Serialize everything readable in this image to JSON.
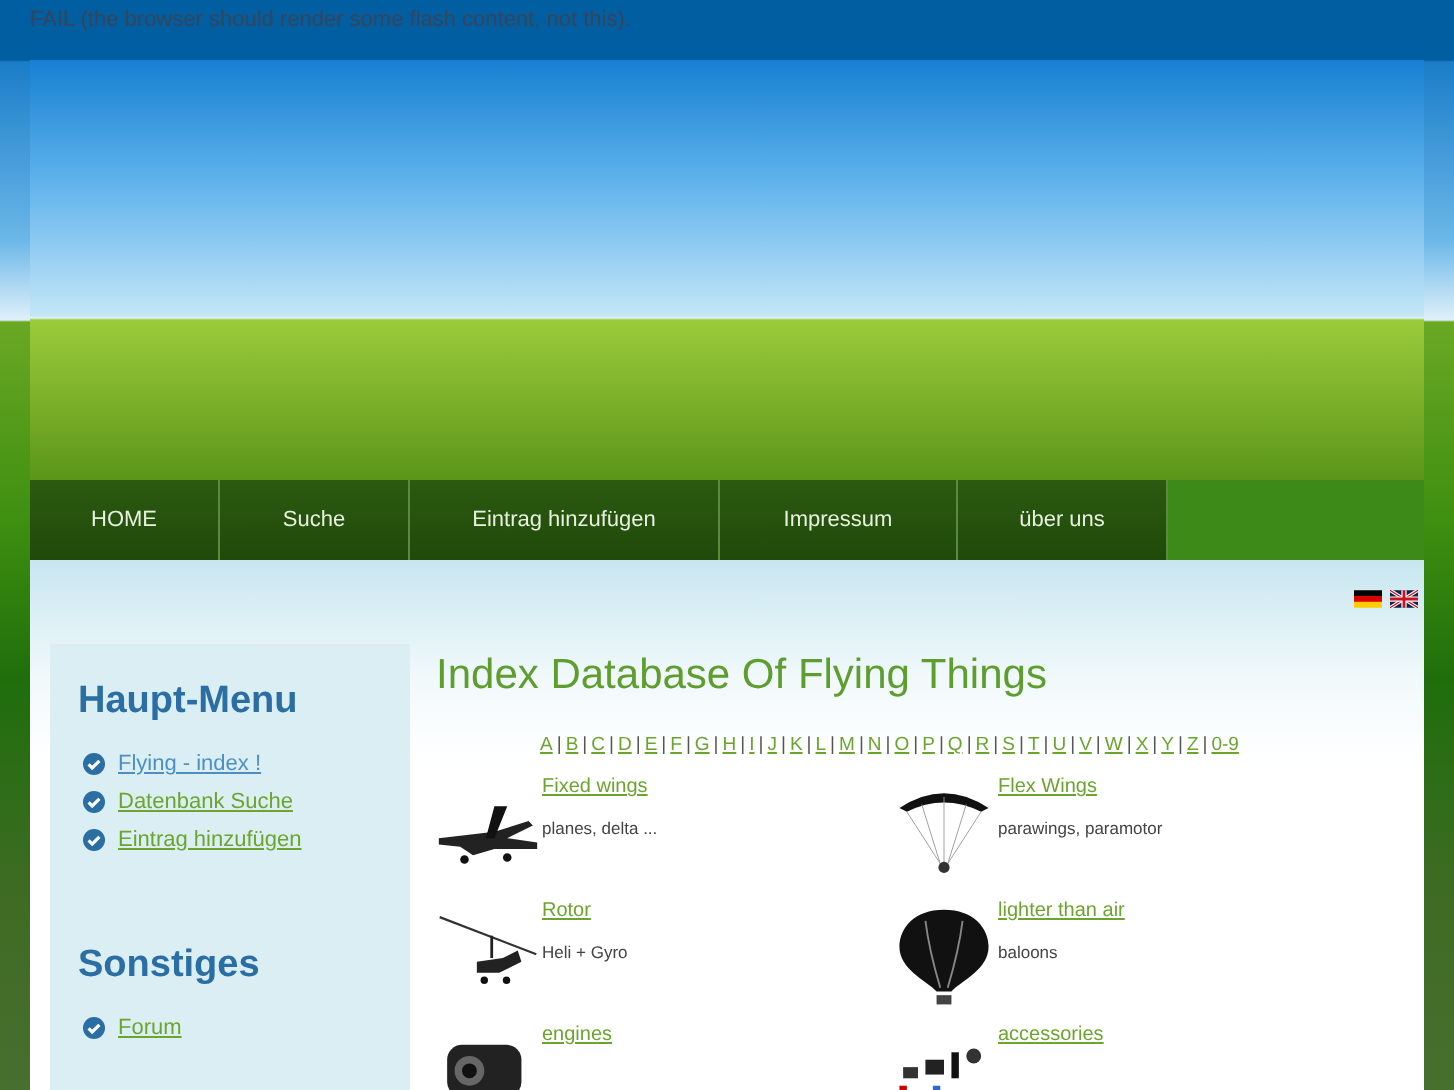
{
  "flash_notice": "FAIL (the browser should render some flash content, not this).",
  "nav": [
    {
      "label": "HOME"
    },
    {
      "label": "Suche"
    },
    {
      "label": "Eintrag hinzufügen"
    },
    {
      "label": "Impressum"
    },
    {
      "label": "über uns"
    }
  ],
  "languages": [
    {
      "kind": "de"
    },
    {
      "kind": "en"
    }
  ],
  "sidebar": [
    {
      "title": "Haupt-Menu",
      "items": [
        {
          "label": "Flying - index !",
          "visited": true
        },
        {
          "label": "Datenbank Suche",
          "visited": false
        },
        {
          "label": "Eintrag hinzufügen",
          "visited": false
        }
      ]
    },
    {
      "title": "Sonstiges",
      "items": [
        {
          "label": "Forum",
          "visited": false
        }
      ]
    }
  ],
  "main": {
    "title": "Index Database Of Flying Things",
    "separator": "|",
    "letters": [
      "A",
      "B",
      "C",
      "D",
      "E",
      "F",
      "G",
      "H",
      "I",
      "J",
      "K",
      "L",
      "M",
      "N",
      "O",
      "P",
      "Q",
      "R",
      "S",
      "T",
      "U",
      "V",
      "W",
      "X",
      "Y",
      "Z",
      "0-9"
    ],
    "categories": [
      {
        "kind": "airplane",
        "name": "Fixed wings",
        "description": "planes, delta ..."
      },
      {
        "kind": "paraglider",
        "name": "Flex Wings",
        "description": "parawings, paramotor"
      },
      {
        "kind": "gyrocopter",
        "name": "Rotor",
        "description": "Heli + Gyro"
      },
      {
        "kind": "balloon",
        "name": "lighter than air",
        "description": "baloons"
      },
      {
        "kind": "engine",
        "name": "engines"
      },
      {
        "kind": "parts",
        "name": "accessories"
      }
    ]
  }
}
